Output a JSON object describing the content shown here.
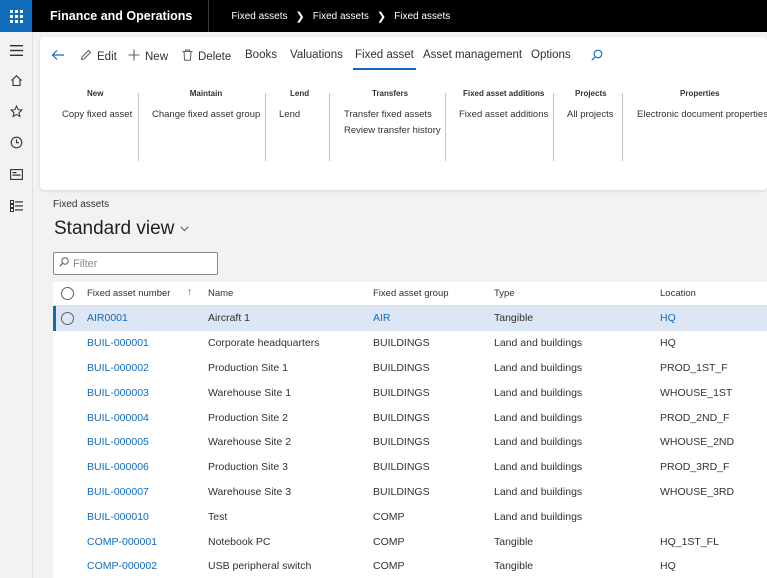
{
  "app": {
    "title": "Finance and Operations"
  },
  "breadcrumb": [
    "Fixed assets",
    "Fixed assets",
    "Fixed assets"
  ],
  "leftnav": {
    "icons": [
      "hamburger-icon",
      "home-icon",
      "star-icon",
      "clock-icon",
      "workspace-icon",
      "modules-icon"
    ]
  },
  "actionpane": {
    "tabs": {
      "edit": "Edit",
      "new": "New",
      "delete": "Delete",
      "books": "Books",
      "valuations": "Valuations",
      "fixed_asset": "Fixed asset",
      "asset_management": "Asset management",
      "options": "Options"
    },
    "groups": {
      "new": {
        "title": "New",
        "items": [
          "Copy fixed asset"
        ]
      },
      "maintain": {
        "title": "Maintain",
        "items": [
          "Change fixed asset group"
        ]
      },
      "lend": {
        "title": "Lend",
        "items": [
          "Lend"
        ]
      },
      "transfers": {
        "title": "Transfers",
        "items": [
          "Transfer fixed assets",
          "Review transfer history"
        ]
      },
      "additions": {
        "title": "Fixed asset additions",
        "items": [
          "Fixed asset additions"
        ]
      },
      "projects": {
        "title": "Projects",
        "items": [
          "All projects"
        ]
      },
      "properties": {
        "title": "Properties",
        "items": [
          "Electronic document properties"
        ]
      }
    }
  },
  "page": {
    "caption": "Fixed assets",
    "view_title": "Standard view",
    "filter_placeholder": "Filter"
  },
  "grid": {
    "headers": {
      "number": "Fixed asset number",
      "name": "Name",
      "group": "Fixed asset group",
      "type": "Type",
      "location": "Location"
    },
    "rows": [
      {
        "number": "AIR0001",
        "name": "Aircraft 1",
        "group": "AIR",
        "type": "Tangible",
        "location": "HQ",
        "selected": true
      },
      {
        "number": "BUIL-000001",
        "name": "Corporate headquarters",
        "group": "BUILDINGS",
        "type": "Land and buildings",
        "location": "HQ"
      },
      {
        "number": "BUIL-000002",
        "name": "Production Site 1",
        "group": "BUILDINGS",
        "type": "Land and buildings",
        "location": "PROD_1ST_F"
      },
      {
        "number": "BUIL-000003",
        "name": "Warehouse Site 1",
        "group": "BUILDINGS",
        "type": "Land and buildings",
        "location": "WHOUSE_1ST"
      },
      {
        "number": "BUIL-000004",
        "name": "Production Site 2",
        "group": "BUILDINGS",
        "type": "Land and buildings",
        "location": "PROD_2ND_F"
      },
      {
        "number": "BUIL-000005",
        "name": "Warehouse Site 2",
        "group": "BUILDINGS",
        "type": "Land and buildings",
        "location": "WHOUSE_2ND"
      },
      {
        "number": "BUIL-000006",
        "name": "Production Site 3",
        "group": "BUILDINGS",
        "type": "Land and buildings",
        "location": "PROD_3RD_F"
      },
      {
        "number": "BUIL-000007",
        "name": "Warehouse Site 3",
        "group": "BUILDINGS",
        "type": "Land and buildings",
        "location": "WHOUSE_3RD"
      },
      {
        "number": "BUIL-000010",
        "name": "Test",
        "group": "COMP",
        "type": "Land and buildings",
        "location": ""
      },
      {
        "number": "COMP-000001",
        "name": "Notebook PC",
        "group": "COMP",
        "type": "Tangible",
        "location": "HQ_1ST_FL"
      },
      {
        "number": "COMP-000002",
        "name": "USB peripheral switch",
        "group": "COMP",
        "type": "Tangible",
        "location": "HQ"
      }
    ]
  }
}
